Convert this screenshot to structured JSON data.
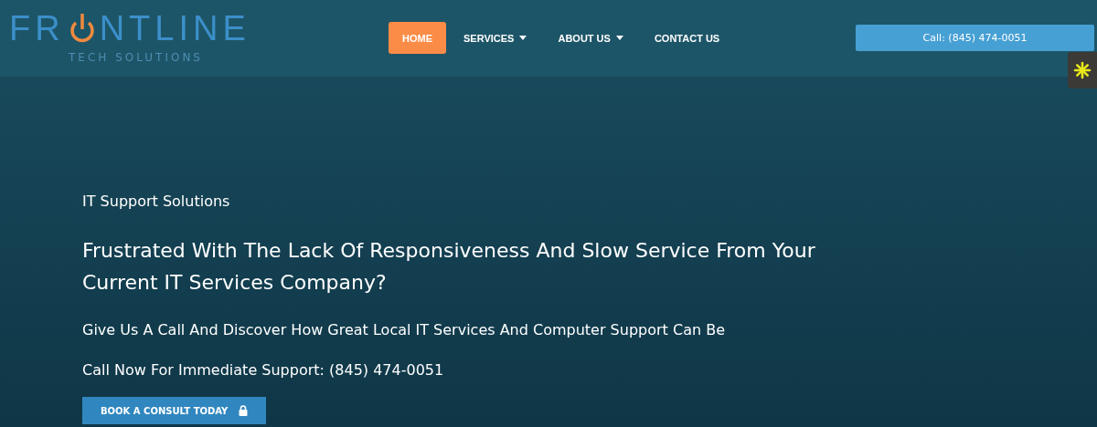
{
  "header": {
    "logo": {
      "name_start": "FR",
      "name_end": "NTLINE",
      "tagline": "TECH SOLUTIONS"
    },
    "nav": [
      {
        "label": "HOME",
        "selected": true,
        "dropdown": false
      },
      {
        "label": "SERVICES",
        "selected": false,
        "dropdown": true
      },
      {
        "label": "ABOUT US",
        "selected": false,
        "dropdown": true
      },
      {
        "label": "CONTACT US",
        "selected": false,
        "dropdown": false
      }
    ],
    "call_button": "Call: (845) 474-0051"
  },
  "hero": {
    "eyebrow": "IT Support Solutions",
    "headline": "Frustrated With The Lack Of Responsiveness And Slow Service From Your Current IT Services Company?",
    "subheading": "Give Us A Call And Discover How Great Local IT Services And Computer Support Can Be",
    "call_line": "Call Now For Immediate Support: (845) 474-0051",
    "cta": "BOOK A CONSULT TODAY"
  }
}
